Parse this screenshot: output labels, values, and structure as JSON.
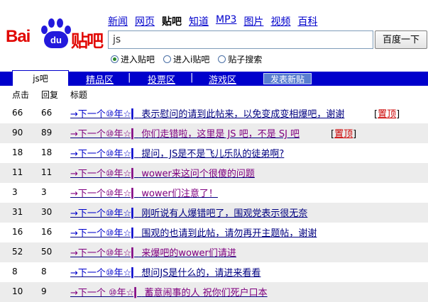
{
  "logo": {
    "bai": "Bai",
    "du": "du",
    "tieba": "贴吧"
  },
  "nav": [
    "新闻",
    "网页",
    "贴吧",
    "知道",
    "MP3",
    "图片",
    "视频",
    "百科"
  ],
  "search": {
    "value": "js",
    "button": "百度一下"
  },
  "radios": [
    {
      "label": "进入贴吧",
      "checked": true
    },
    {
      "label": "进入i贴吧",
      "checked": false
    },
    {
      "label": "贴子搜索",
      "checked": false
    }
  ],
  "tabs": {
    "active": "js吧",
    "links": [
      "精品区",
      "投票区",
      "游戏区"
    ],
    "separator": "|",
    "post": "发表新贴"
  },
  "columns": {
    "clicks": "点击",
    "replies": "回复",
    "title": "标题"
  },
  "pin_label": "置顶",
  "posts": [
    {
      "clicks": "66",
      "replies": "66",
      "prefix": "→下一个⑩年☆▎",
      "text": "表示慰问的请到此帖来，以免变成变相爆吧，谢谢",
      "pinned": true,
      "visited": false
    },
    {
      "clicks": "90",
      "replies": "89",
      "prefix": "→下一个⑩年☆▎",
      "text": "你们走错啦，这里是 JS 吧，不是 SJ 吧",
      "pinned": true,
      "visited": true
    },
    {
      "clicks": "18",
      "replies": "18",
      "prefix": "→下一个⑩年☆▎",
      "text": "提问，JS是不是飞儿乐队的徒弟啊?",
      "pinned": false,
      "visited": false
    },
    {
      "clicks": "11",
      "replies": "11",
      "prefix": "→下一个⑩年☆▎",
      "text": "wower来这问个很傻的问题",
      "pinned": false,
      "visited": true
    },
    {
      "clicks": "3",
      "replies": "3",
      "prefix": "→下一个⑩年☆▎",
      "text": "wower们注意了！",
      "pinned": false,
      "visited": true
    },
    {
      "clicks": "31",
      "replies": "30",
      "prefix": "→下一个⑩年☆▎",
      "text": "刚听说有人爆错吧了，围观党表示很无奈",
      "pinned": false,
      "visited": false
    },
    {
      "clicks": "16",
      "replies": "16",
      "prefix": "→下一个⑩年☆▎",
      "text": "围观的也请到此帖，请勿再开主题帖，谢谢",
      "pinned": false,
      "visited": false
    },
    {
      "clicks": "52",
      "replies": "50",
      "prefix": "→下一个⑩年☆▎",
      "text": "来爆吧的wower们请进",
      "pinned": false,
      "visited": true
    },
    {
      "clicks": "8",
      "replies": "8",
      "prefix": "→下一个⑩年☆▎",
      "text": "想问JS是什么的，请进来看看",
      "pinned": false,
      "visited": false
    },
    {
      "clicks": "10",
      "replies": "9",
      "prefix": "→下一个 ⑩年☆▎",
      "text": "蓄意闹事的人 祝你们死户口本",
      "pinned": false,
      "visited": true
    }
  ],
  "colors": {
    "tabbar": "#0000cc",
    "logo_red": "#e10601",
    "logo_blue": "#2319dc",
    "link": "#0000cc",
    "visited": "#800080",
    "pin": "#cc0000"
  }
}
